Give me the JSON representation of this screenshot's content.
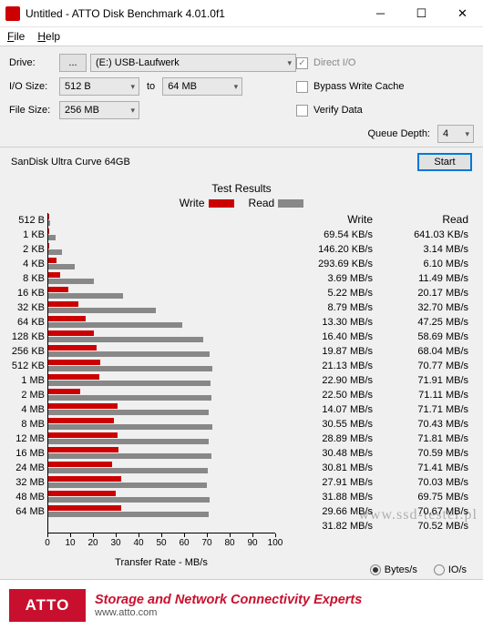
{
  "window": {
    "title": "Untitled - ATTO Disk Benchmark 4.01.0f1"
  },
  "menu": {
    "file": "File",
    "help": "Help"
  },
  "labels": {
    "drive": "Drive:",
    "iosize": "I/O Size:",
    "filesize": "File Size:",
    "to": "to",
    "queue": "Queue Depth:",
    "start": "Start",
    "direct": "Direct I/O",
    "bypass": "Bypass Write Cache",
    "verify": "Verify Data",
    "results": "Test Results",
    "write": "Write",
    "read": "Read",
    "xlabel": "Transfer Rate - MB/s",
    "bytes": "Bytes/s",
    "ios": "IO/s",
    "browse": "..."
  },
  "fields": {
    "drive": "(E:) USB-Laufwerk",
    "io_from": "512 B",
    "io_to": "64 MB",
    "filesize": "256 MB",
    "queue": "4"
  },
  "device": "SanDisk Ultra Curve 64GB",
  "footer": {
    "logo": "ATTO",
    "line1": "Storage and Network Connectivity Experts",
    "line2": "www.atto.com"
  },
  "watermark": "www.ssd-tester.pl",
  "chart_data": {
    "type": "bar",
    "xlabel": "Transfer Rate - MB/s",
    "xlim": [
      0,
      100
    ],
    "xticks": [
      0,
      10,
      20,
      30,
      40,
      50,
      60,
      70,
      80,
      90,
      100
    ],
    "categories": [
      "512 B",
      "1 KB",
      "2 KB",
      "4 KB",
      "8 KB",
      "16 KB",
      "32 KB",
      "64 KB",
      "128 KB",
      "256 KB",
      "512 KB",
      "1 MB",
      "2 MB",
      "4 MB",
      "8 MB",
      "12 MB",
      "16 MB",
      "24 MB",
      "32 MB",
      "48 MB",
      "64 MB"
    ],
    "series": [
      {
        "name": "Write",
        "values_label": [
          "69.54 KB/s",
          "146.20 KB/s",
          "293.69 KB/s",
          "3.69 MB/s",
          "5.22 MB/s",
          "8.79 MB/s",
          "13.30 MB/s",
          "16.40 MB/s",
          "19.87 MB/s",
          "21.13 MB/s",
          "22.90 MB/s",
          "22.50 MB/s",
          "14.07 MB/s",
          "30.55 MB/s",
          "28.89 MB/s",
          "30.48 MB/s",
          "30.81 MB/s",
          "27.91 MB/s",
          "31.88 MB/s",
          "29.66 MB/s",
          "31.82 MB/s"
        ],
        "values_mb": [
          0.07,
          0.15,
          0.29,
          3.69,
          5.22,
          8.79,
          13.3,
          16.4,
          19.87,
          21.13,
          22.9,
          22.5,
          14.07,
          30.55,
          28.89,
          30.48,
          30.81,
          27.91,
          31.88,
          29.66,
          31.82
        ]
      },
      {
        "name": "Read",
        "values_label": [
          "641.03 KB/s",
          "3.14 MB/s",
          "6.10 MB/s",
          "11.49 MB/s",
          "20.17 MB/s",
          "32.70 MB/s",
          "47.25 MB/s",
          "58.69 MB/s",
          "68.04 MB/s",
          "70.77 MB/s",
          "71.91 MB/s",
          "71.11 MB/s",
          "71.71 MB/s",
          "70.43 MB/s",
          "71.81 MB/s",
          "70.59 MB/s",
          "71.41 MB/s",
          "70.03 MB/s",
          "69.75 MB/s",
          "70.67 MB/s",
          "70.52 MB/s"
        ],
        "values_mb": [
          0.64,
          3.14,
          6.1,
          11.49,
          20.17,
          32.7,
          47.25,
          58.69,
          68.04,
          70.77,
          71.91,
          71.11,
          71.71,
          70.43,
          71.81,
          70.59,
          71.41,
          70.03,
          69.75,
          70.67,
          70.52
        ]
      }
    ]
  }
}
